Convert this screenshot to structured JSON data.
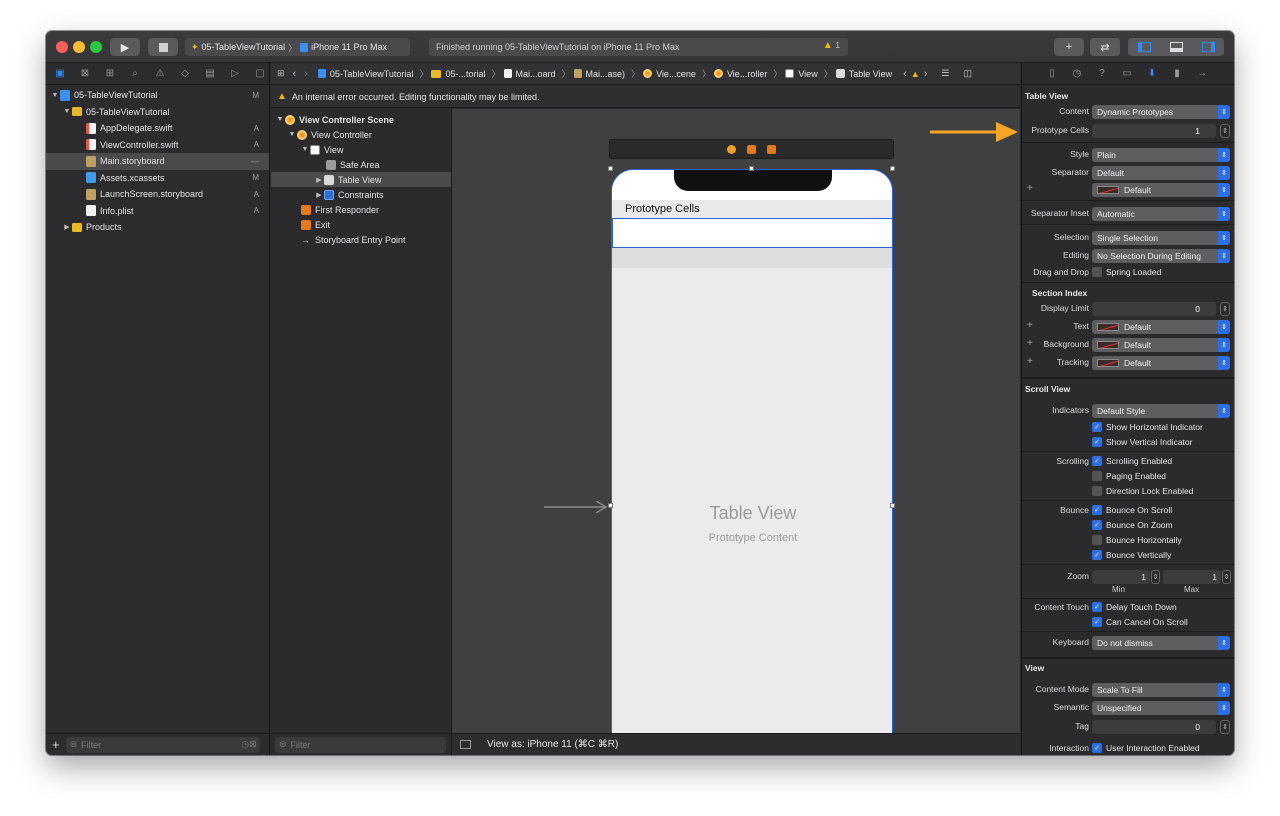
{
  "toolbar": {
    "scheme_project": "05-TableViewTutorial",
    "scheme_device": "iPhone 11 Pro Max",
    "status_text": "Finished running 05-TableViewTutorial on iPhone 11 Pro Max",
    "warning_count": "1"
  },
  "navigator": {
    "items": [
      {
        "label": "05-TableViewTutorial",
        "mark": "M"
      },
      {
        "label": "05-TableViewTutorial",
        "mark": ""
      },
      {
        "label": "AppDelegate.swift",
        "mark": "A"
      },
      {
        "label": "ViewController.swift",
        "mark": "A"
      },
      {
        "label": "Main.storyboard",
        "mark": "—"
      },
      {
        "label": "Assets.xcassets",
        "mark": "M"
      },
      {
        "label": "LaunchScreen.storyboard",
        "mark": "A"
      },
      {
        "label": "Info.plist",
        "mark": "A"
      },
      {
        "label": "Products",
        "mark": ""
      }
    ],
    "filter_placeholder": "Filter"
  },
  "jumpbar": {
    "crumbs": [
      "05-TableViewTutorial",
      "05-...torial",
      "Mai...oard",
      "Mai...ase)",
      "Vie...cene",
      "Vie...roller",
      "View",
      "Table View"
    ]
  },
  "error_bar": {
    "text": "An internal error occurred. Editing functionality may be limited."
  },
  "outline": {
    "items": [
      "View Controller Scene",
      "View Controller",
      "View",
      "Safe Area",
      "Table View",
      "Constraints",
      "First Responder",
      "Exit",
      "Storyboard Entry Point"
    ],
    "filter_placeholder": "Filter"
  },
  "canvas": {
    "prototype_cells_header": "Prototype Cells",
    "table_view_label": "Table View",
    "prototype_content_label": "Prototype Content",
    "view_as": "View as: iPhone 11 (⌘C ⌘R)"
  },
  "inspector": {
    "table_view_section": "Table View",
    "content_label": "Content",
    "content_value": "Dynamic Prototypes",
    "prototype_cells_label": "Prototype Cells",
    "prototype_cells_value": "1",
    "style_label": "Style",
    "style_value": "Plain",
    "separator_label": "Separator",
    "separator_value": "Default",
    "separator_color_value": "Default",
    "separator_inset_label": "Separator Inset",
    "separator_inset_value": "Automatic",
    "selection_label": "Selection",
    "selection_value": "Single Selection",
    "editing_label": "Editing",
    "editing_value": "No Selection During Editing",
    "drag_drop_label": "Drag and Drop",
    "drag_drop_value": "Spring Loaded",
    "section_index_title": "Section Index",
    "display_limit_label": "Display Limit",
    "display_limit_value": "0",
    "text_label": "Text",
    "text_value": "Default",
    "background_label": "Background",
    "background_value": "Default",
    "tracking_label": "Tracking",
    "tracking_value": "Default",
    "scroll_view_section": "Scroll View",
    "indicators_label": "Indicators",
    "indicators_value": "Default Style",
    "show_horizontal": "Show Horizontal Indicator",
    "show_vertical": "Show Vertical Indicator",
    "scrolling_label": "Scrolling",
    "scrolling_enabled": "Scrolling Enabled",
    "paging_enabled": "Paging Enabled",
    "direction_lock": "Direction Lock Enabled",
    "bounce_label": "Bounce",
    "bounce_on_scroll": "Bounce On Scroll",
    "bounce_on_zoom": "Bounce On Zoom",
    "bounce_horizontally": "Bounce Horizontally",
    "bounce_vertically": "Bounce Vertically",
    "zoom_label": "Zoom",
    "zoom_min": "1",
    "zoom_max": "1",
    "zoom_min_label": "Min",
    "zoom_max_label": "Max",
    "content_touch_label": "Content Touch",
    "delay_touch_down": "Delay Touch Down",
    "can_cancel_on_scroll": "Can Cancel On Scroll",
    "keyboard_label": "Keyboard",
    "keyboard_value": "Do not dismiss",
    "view_section": "View",
    "content_mode_label": "Content Mode",
    "content_mode_value": "Scale To Fill",
    "semantic_label": "Semantic",
    "semantic_value": "Unspecified",
    "tag_label": "Tag",
    "tag_value": "0",
    "interaction_label": "Interaction",
    "user_interaction": "User Interaction Enabled"
  },
  "colors": {
    "accent": "#2b6fe6",
    "annotation_arrow": "#f5a623",
    "warning": "#f5b700"
  }
}
